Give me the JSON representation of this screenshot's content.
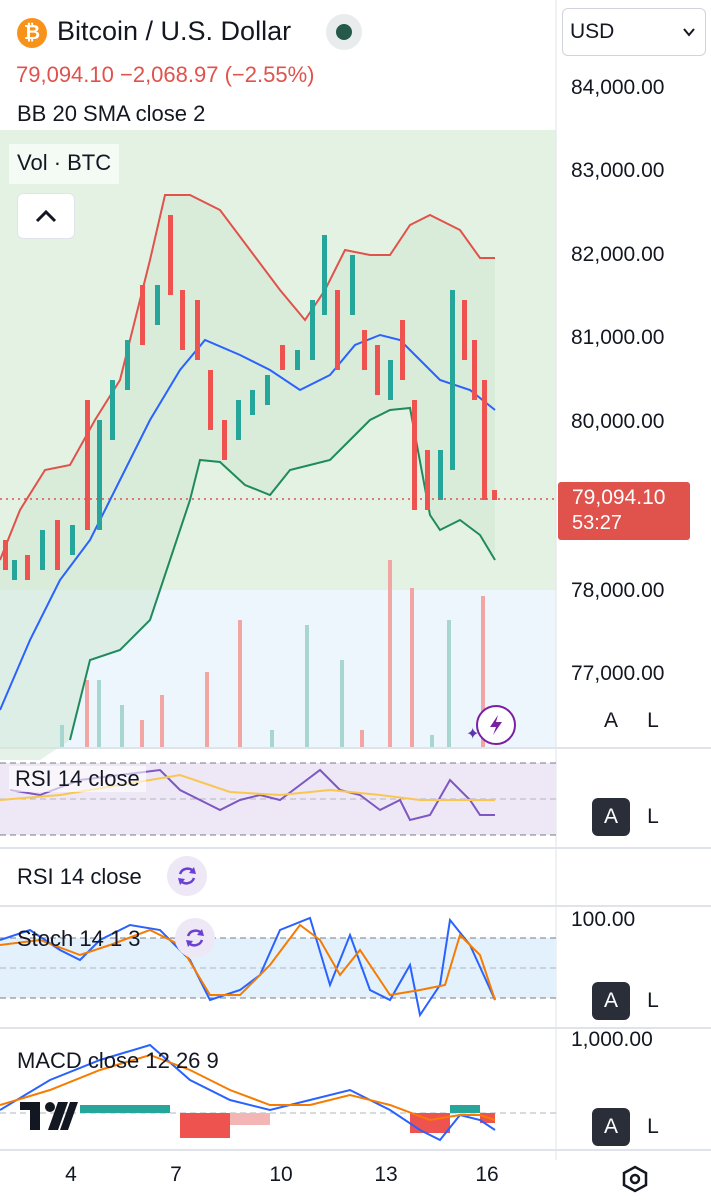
{
  "header": {
    "title": "Bitcoin / U.S. Dollar",
    "price_line": "79,094.10 −2,068.97 (−2.55%)",
    "indicator_bb": "BB 20 SMA close 2",
    "indicator_vol": "Vol · BTC",
    "currency": "USD",
    "status_color": "#26594a"
  },
  "price_axis": {
    "labels": [
      "84,000.00",
      "83,000.00",
      "82,000.00",
      "81,000.00",
      "80,000.00",
      "78,000.00",
      "77,000.00"
    ],
    "current_price": "79,094.10",
    "countdown": "53:27",
    "current_color": "#e0524c"
  },
  "panels": {
    "rsi1": {
      "title": "RSI 14 close"
    },
    "rsi2": {
      "title": "RSI 14 close"
    },
    "stoch": {
      "title": "Stoch 14 1 3",
      "axis_label": "100.00"
    },
    "macd": {
      "title": "MACD close 12 26 9",
      "axis_label": "1,000.00"
    }
  },
  "scale_buttons": {
    "auto": "A",
    "log": "L"
  },
  "x_axis": {
    "labels": [
      "4",
      "7",
      "10",
      "13",
      "16"
    ]
  },
  "colors": {
    "up": "#26a69a",
    "down": "#ef5350",
    "bb_upper": "#e0524c",
    "bb_basis": "#2962ff",
    "bb_lower": "#1f8a5c"
  }
}
